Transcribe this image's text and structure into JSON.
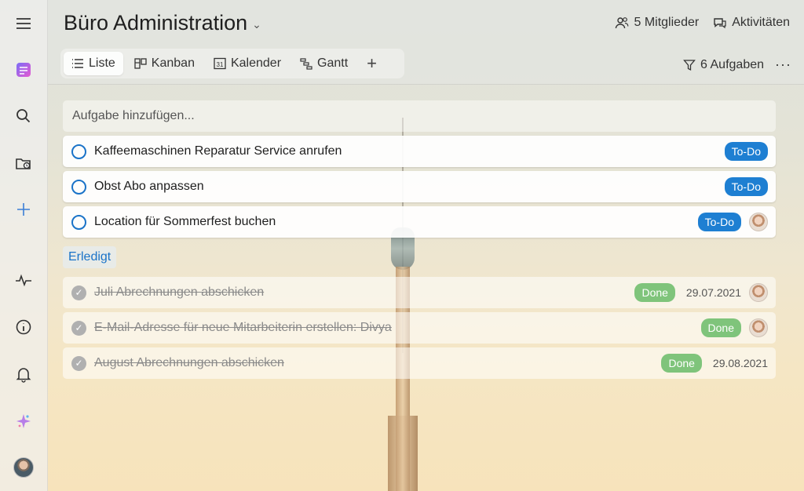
{
  "colors": {
    "accent": "#1e7fd2",
    "done": "#7fc47b",
    "section": "#1a73c8"
  },
  "sidebar": {
    "items": [
      {
        "icon": "menu-icon"
      },
      {
        "icon": "app-logo-icon"
      },
      {
        "icon": "search-icon"
      },
      {
        "icon": "folder-clock-icon"
      },
      {
        "icon": "plus-icon"
      },
      {
        "icon": "activity-icon"
      },
      {
        "icon": "info-icon"
      },
      {
        "icon": "bell-icon"
      },
      {
        "icon": "sparkle-icon"
      },
      {
        "icon": "user-avatar"
      }
    ]
  },
  "header": {
    "title": "Büro Administration",
    "members": "5 Mitglieder",
    "activities": "Aktivitäten"
  },
  "tabs": [
    {
      "label": "Liste",
      "icon": "list-icon",
      "active": true
    },
    {
      "label": "Kanban",
      "icon": "kanban-icon"
    },
    {
      "label": "Kalender",
      "icon": "calendar-icon",
      "icon_text": "31"
    },
    {
      "label": "Gantt",
      "icon": "gantt-icon"
    }
  ],
  "tab_add": "+",
  "filter": {
    "label": "6 Aufgaben",
    "more": "···"
  },
  "add_task": {
    "placeholder": "Aufgabe hinzufügen..."
  },
  "open_tasks": [
    {
      "label": "Kaffeemaschinen Reparatur Service anrufen",
      "status": "To-Do",
      "avatar": false
    },
    {
      "label": "Obst Abo anpassen",
      "status": "To-Do",
      "avatar": false
    },
    {
      "label": "Location für Sommerfest buchen",
      "status": "To-Do",
      "avatar": true
    }
  ],
  "done_section": "Erledigt",
  "done_tasks": [
    {
      "label": "Juli Abrechnungen abschicken",
      "status": "Done",
      "date": "29.07.2021",
      "avatar": true
    },
    {
      "label": "E-Mail-Adresse für neue Mitarbeiterin erstellen: Divya",
      "status": "Done",
      "date": "",
      "avatar": true
    },
    {
      "label": "August Abrechnungen abschicken",
      "status": "Done",
      "date": "29.08.2021",
      "avatar": false
    }
  ]
}
